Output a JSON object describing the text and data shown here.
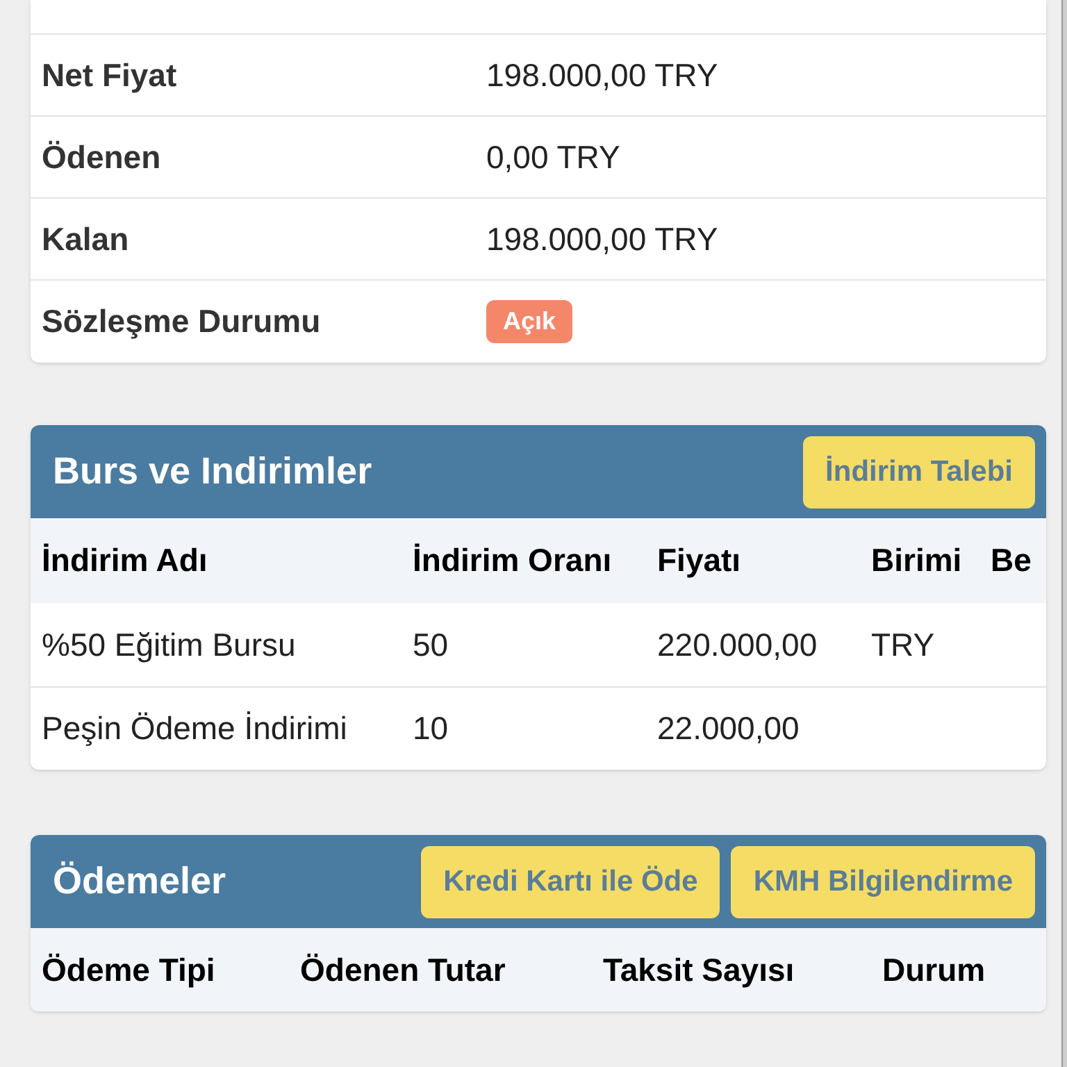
{
  "summary": {
    "rows": [
      {
        "label": "Net Fiyat",
        "value": "198.000,00 TRY"
      },
      {
        "label": "Ödenen",
        "value": "0,00 TRY"
      },
      {
        "label": "Kalan",
        "value": "198.000,00 TRY"
      }
    ],
    "status": {
      "label": "Sözleşme Durumu",
      "badge": "Açık",
      "color": "#f4876a"
    }
  },
  "discounts": {
    "title": "Burs ve Indirimler",
    "buttons": [
      "İndirim Talebi"
    ],
    "table": {
      "columns": [
        "İndirim Adı",
        "İndirim Oranı",
        "Fiyatı",
        "Birimi",
        "Be"
      ],
      "rows": [
        [
          "%50 Eğitim Bursu",
          "50",
          "220.000,00",
          "TRY",
          ""
        ],
        [
          "Peşin Ödeme İndirimi",
          "10",
          "22.000,00",
          "",
          ""
        ]
      ]
    }
  },
  "payments": {
    "title": "Ödemeler",
    "buttons": [
      "Kredi Kartı ile Öde",
      "KMH Bilgilendirme"
    ],
    "table": {
      "columns": [
        "Ödeme Tipi",
        "Ödenen Tutar",
        "Taksit Sayısı",
        "Durum"
      ]
    }
  }
}
